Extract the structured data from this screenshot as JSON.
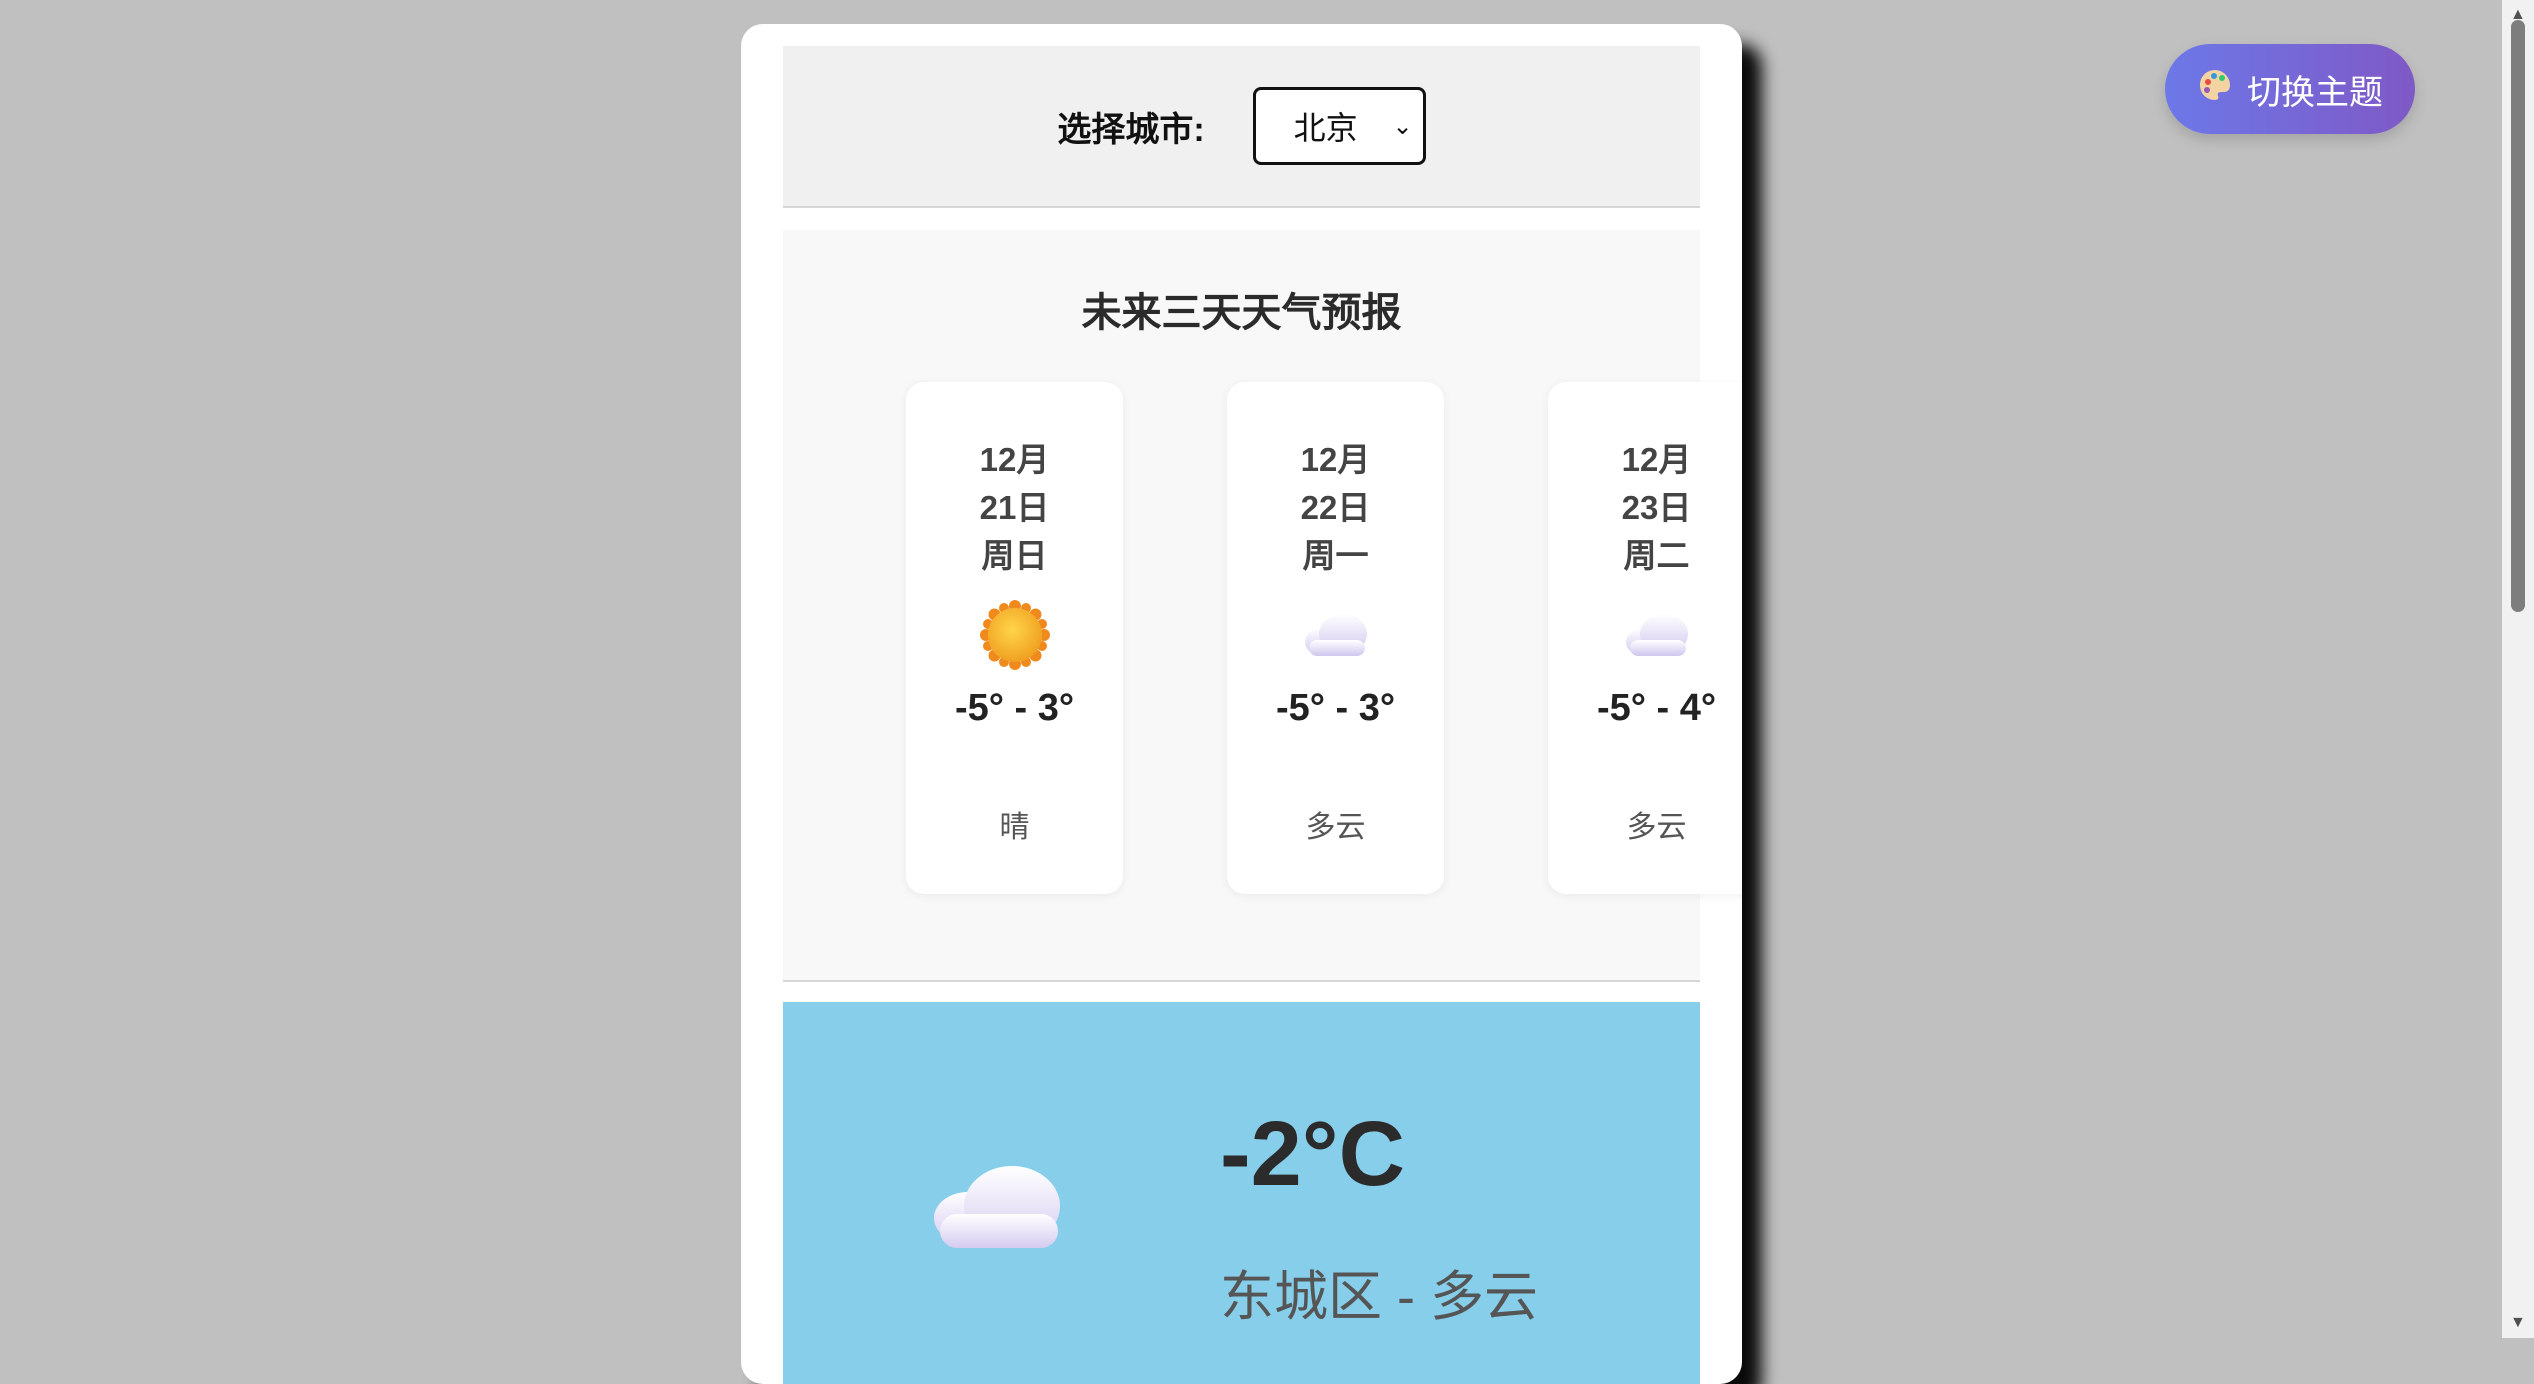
{
  "city_selector": {
    "label": "选择城市:",
    "selected": "北京"
  },
  "forecast": {
    "title": "未来三天天气预报",
    "days": [
      {
        "month": "12月",
        "day": "21日",
        "weekday": "周日",
        "icon": "sun-icon",
        "temp": "-5° - 3°",
        "desc": "晴"
      },
      {
        "month": "12月",
        "day": "22日",
        "weekday": "周一",
        "icon": "cloud-icon",
        "temp": "-5° - 3°",
        "desc": "多云"
      },
      {
        "month": "12月",
        "day": "23日",
        "weekday": "周二",
        "icon": "cloud-icon",
        "temp": "-5° - 4°",
        "desc": "多云"
      }
    ]
  },
  "current": {
    "temperature": "-2°C",
    "location": "东城区 - 多云",
    "icon": "cloud-icon"
  },
  "theme_button": {
    "label": "切换主题",
    "icon": "palette-icon"
  },
  "colors": {
    "page_bg": "#c0c0c0",
    "current_bg": "#87ceeb",
    "theme_button_start": "#6d78e8",
    "theme_button_end": "#7f59c6"
  }
}
